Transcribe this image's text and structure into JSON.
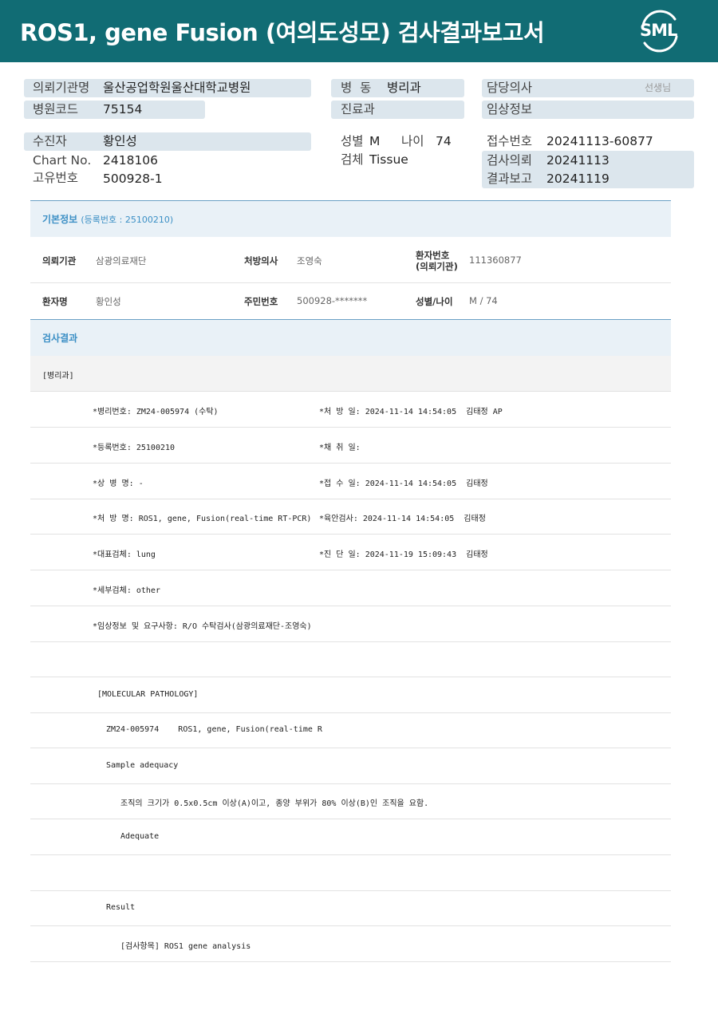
{
  "header": {
    "title": "ROS1, gene Fusion (여의도성모) 검사결과보고서",
    "logo_text": "SML"
  },
  "summary": {
    "requesting_org_label": "의뢰기관명",
    "requesting_org_value": "울산공업학원울산대학교병원",
    "hospital_code_label": "병원코드",
    "hospital_code_value": "75154",
    "ward_label": "병  동",
    "ward_value": "병리과",
    "department_label": "진료과",
    "department_value": "",
    "doctor_label": "담당의사",
    "doctor_suffix": "선생님",
    "clinical_info_label": "임상정보",
    "patient_label": "수진자",
    "patient_value": "황인성",
    "chart_no_label": "Chart No.",
    "chart_no_value": "2418106",
    "unique_no_label": "고유번호",
    "unique_no_value": "500928-1",
    "sex_label": "성별",
    "sex_value": "M",
    "age_label": "나이",
    "age_value": "74",
    "specimen_label": "검체",
    "specimen_value": "Tissue",
    "receipt_no_label": "접수번호",
    "receipt_no_value": "20241113-60877",
    "test_request_label": "검사의뢰",
    "test_request_value": "20241113",
    "result_report_label": "결과보고",
    "result_report_value": "20241119"
  },
  "basic_info": {
    "title": "기본정보",
    "reg_no": "(등록번호 : 25100210)",
    "org_key": "의뢰기관",
    "org_val": "삼광의료재단",
    "prescriber_key": "처방의사",
    "prescriber_val": "조영숙",
    "patient_no_key_1": "환자번호",
    "patient_no_key_2": "(의뢰기관)",
    "patient_no_val": "111360877",
    "name_key": "환자명",
    "name_val": "황인성",
    "rrn_key": "주민번호",
    "rrn_val": "500928-*******",
    "sexage_key": "성별/나이",
    "sexage_val": "M / 74"
  },
  "results": {
    "title": "검사결과",
    "dept": "[병리과]",
    "rows": [
      {
        "left": "*병리번호: ZM24-005974 (수탁)",
        "right": "*처 방 일: 2024-11-14 14:54:05  김태정 AP"
      },
      {
        "left": "*등록번호: 25100210",
        "right": "*채 취 일:"
      },
      {
        "left": "*상 병 명: -",
        "right": "*접 수 일: 2024-11-14 14:54:05  김태정"
      },
      {
        "left": "*처 방 명: ROS1, gene, Fusion(real-time RT-PCR)",
        "right": "*육안검사: 2024-11-14 14:54:05  김태정"
      },
      {
        "left": "*대표검체: lung",
        "right": "*진 단 일: 2024-11-19 15:09:43  김태정"
      },
      {
        "left": "*세부검체: other",
        "right": ""
      },
      {
        "left": "*임상정보 및 요구사항: R/O 수탁검사(삼광의료재단-조영숙)",
        "right": ""
      }
    ],
    "mp_title": "[MOLECULAR PATHOLOGY]",
    "mp_line": "ZM24-005974    ROS1, gene, Fusion(real-time R",
    "adequacy_title": "Sample adequacy",
    "adequacy_desc": "조직의 크기가 0.5x0.5cm 이상(A)이고, 종양 부위가 80% 이상(B)인 조직을 요함.",
    "adequacy_value": "Adequate",
    "result_title": "Result",
    "result_item": "[검사항목] ROS1 gene analysis"
  }
}
